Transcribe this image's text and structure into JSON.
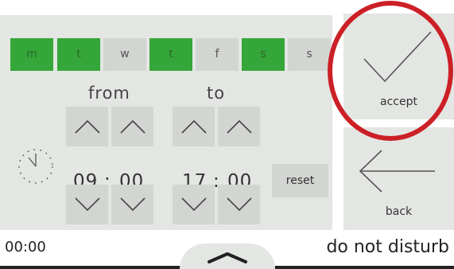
{
  "days": [
    {
      "label": "m",
      "active": true
    },
    {
      "label": "t",
      "active": true
    },
    {
      "label": "w",
      "active": false
    },
    {
      "label": "t",
      "active": true
    },
    {
      "label": "f",
      "active": false
    },
    {
      "label": "s",
      "active": true
    },
    {
      "label": "s",
      "active": false
    }
  ],
  "schedule": {
    "from_label": "from",
    "to_label": "to",
    "from_hour": "09",
    "from_minute": "00",
    "to_hour": "17",
    "to_minute": "00",
    "separator": ":"
  },
  "buttons": {
    "reset": "reset",
    "accept": "accept",
    "back": "back"
  },
  "status": {
    "time": "00:00",
    "mode": "do not disturb"
  },
  "colors": {
    "active_day": "#35a639",
    "inactive_day": "#d2d5d1",
    "panel": "#e3e6e2",
    "highlight": "#cc1f26"
  },
  "icons": {
    "clock": "clock-icon",
    "up": "chevron-up-icon",
    "down": "chevron-down-icon",
    "accept": "checkmark-icon",
    "back": "arrow-left-icon",
    "handle": "chevron-up-icon"
  }
}
